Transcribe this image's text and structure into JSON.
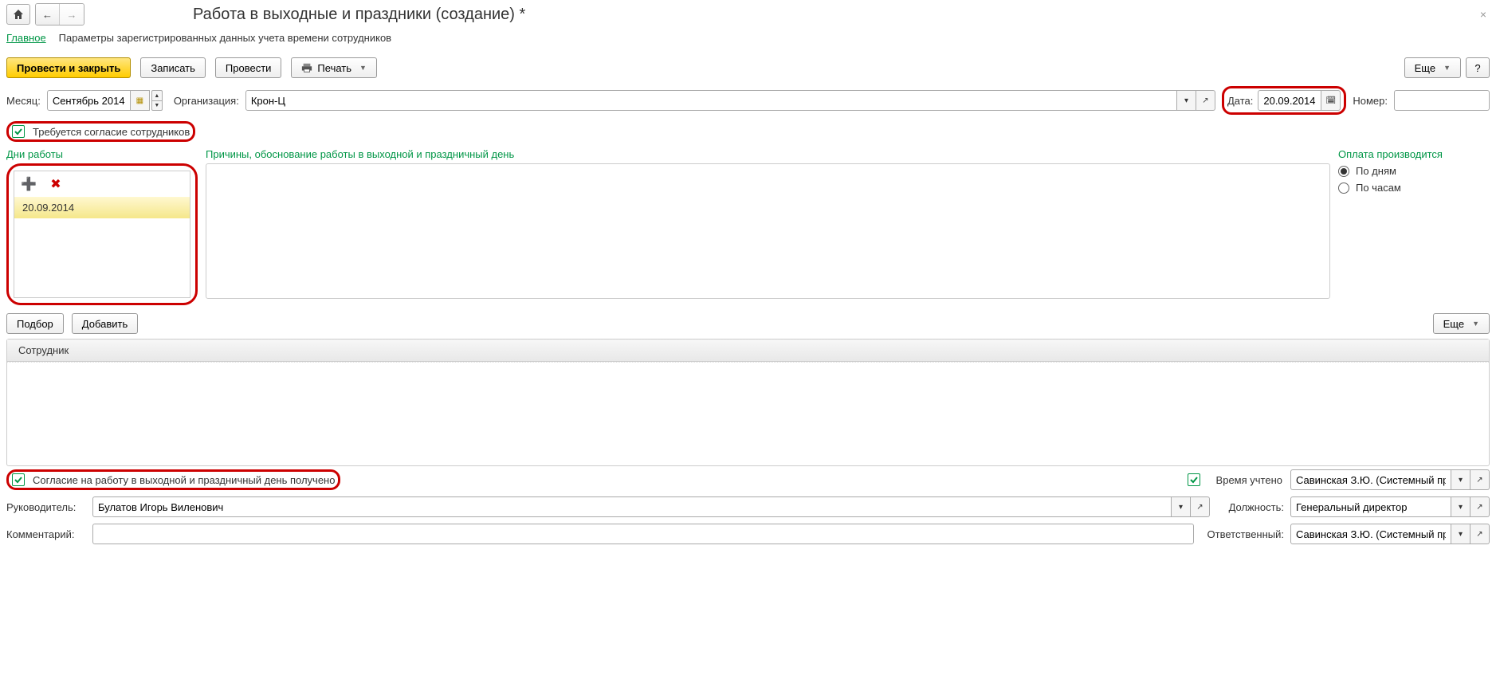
{
  "page_title": "Работа в выходные и праздники (создание) *",
  "tabs": {
    "main": "Главное",
    "params": "Параметры зарегистрированных данных учета времени сотрудников"
  },
  "buttons": {
    "post_close": "Провести и закрыть",
    "save": "Записать",
    "post": "Провести",
    "print": "Печать",
    "more": "Еще",
    "help": "?",
    "pick": "Подбор",
    "add": "Добавить"
  },
  "fields": {
    "month_label": "Месяц:",
    "month_value": "Сентябрь 2014",
    "org_label": "Организация:",
    "org_value": "Крон-Ц",
    "date_label": "Дата:",
    "date_value": "20.09.2014",
    "number_label": "Номер:",
    "number_value": ""
  },
  "checkboxes": {
    "consent_required": "Требуется согласие сотрудников",
    "consent_received": "Согласие на работу в выходной и праздничный день получено",
    "time_counted": "Время учтено"
  },
  "sections": {
    "days_label": "Дни работы",
    "reason_label": "Причины, обоснование работы в выходной и праздничный день",
    "payment_label": "Оплата производится"
  },
  "days": {
    "row1": "20.09.2014"
  },
  "payment": {
    "by_days": "По дням",
    "by_hours": "По часам",
    "selected": "by_days"
  },
  "table": {
    "col_employee": "Сотрудник"
  },
  "footer": {
    "time_user_value": "Савинская З.Ю. (Системный прогр",
    "manager_label": "Руководитель:",
    "manager_value": "Булатов Игорь Виленович",
    "position_label": "Должность:",
    "position_value": "Генеральный директор",
    "comment_label": "Комментарий:",
    "comment_value": "",
    "responsible_label": "Ответственный:",
    "responsible_value": "Савинская З.Ю. (Системный прогр"
  }
}
